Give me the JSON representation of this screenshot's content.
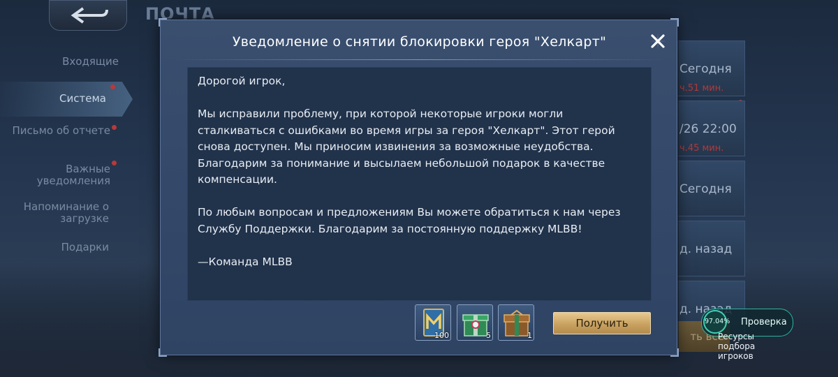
{
  "background": {
    "screen_title": "ПОЧТА",
    "menu": [
      {
        "label": "Входящие",
        "dot": false
      },
      {
        "label": "Система",
        "dot": true
      },
      {
        "label": "Письмо об отчете",
        "dot": true
      },
      {
        "label": "Важные уведомления",
        "dot": true
      },
      {
        "label": "Напоминание о загрузке",
        "dot": false
      },
      {
        "label": "Подарки",
        "dot": false
      }
    ],
    "list": [
      {
        "date": "Сегодня",
        "time": "ч.51 мин."
      },
      {
        "date": "/26 22:00",
        "time": "ч.45 мин."
      },
      {
        "date": "Сегодня",
        "time": ""
      },
      {
        "date": "д. назад",
        "time": ""
      },
      {
        "date": "д. назад",
        "time": ""
      }
    ],
    "right_button": "ть все"
  },
  "modal": {
    "title": "Уведомление о снятии блокировки героя \"Хелкарт\"",
    "body": "Дорогой игрок,\n\nМы исправили проблему, при которой некоторые игроки могли сталкиваться с ошибками во время игры за героя \"Хелкарт\". Этот герой снова доступен. Мы приносим извинения за возможные неудобства. Благодарим за понимание и высылаем небольшой подарок в качестве компенсации.\n\nПо любым вопросам и предложениям Вы можете обратиться к нам через Службу Поддержки. Благодарим за постоянную поддержку MLBB!\n\n—Команда MLBB",
    "rewards": [
      {
        "icon": "m-card-icon",
        "count": "100"
      },
      {
        "icon": "green-gift-box-icon",
        "count": "5"
      },
      {
        "icon": "golden-chest-icon",
        "count": "1"
      }
    ],
    "claim_label": "Получить"
  },
  "check_widget": {
    "percent": "97.04%",
    "label": "Проверка",
    "sub": "Ресурсы подбора игроков"
  },
  "colors": {
    "accent_gold": "#c9a261",
    "panel": "#21324b",
    "check_teal": "#3fd2b5",
    "alert_red": "#b8393a"
  }
}
